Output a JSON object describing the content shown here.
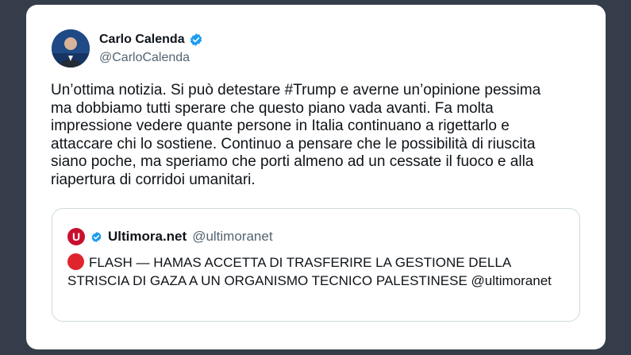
{
  "tweet": {
    "author_name": "Carlo Calenda",
    "author_handle": "@CarloCalenda",
    "text": "Un’ottima notizia. Si può detestare #Trump e averne un’opinione pessima\nma dobbiamo tutti sperare che questo piano vada avanti. Fa molta\nimpressione vedere quante persone in Italia continuano a rigettarlo e\nattaccare chi lo sostiene. Continuo a pensare che le possibilità di riuscita\nsiano poche, ma speriamo che porti almeno ad un cessate il fuoco e alla\nriapertura di corridoi umanitari."
  },
  "quote": {
    "author_name": "Ultimora.net",
    "author_handle": "@ultimoranet",
    "logo_letter": "U",
    "text": "FLASH — HAMAS ACCETTA DI TRASFERIRE LA GESTIONE DELLA STRISCIA DI GAZA A UN ORGANISMO TECNICO PALESTINESE @ultimoranet"
  },
  "colors": {
    "background": "#353d4a",
    "card": "#ffffff",
    "verified": "#1d9bf0",
    "flash_dot": "#e0242e",
    "logo": "#c8102e"
  },
  "icons": {
    "verified": "verified-badge-icon",
    "flash": "red-circle-icon"
  }
}
